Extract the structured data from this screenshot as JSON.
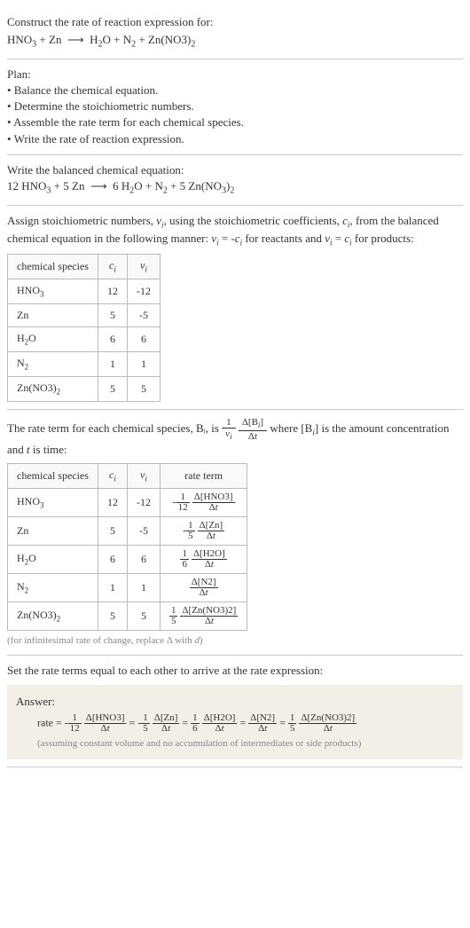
{
  "header": {
    "title": "Construct the rate of reaction expression for:",
    "equation": "HNO₃ + Zn ⟶ H₂O + N₂ + Zn(NO3)₂"
  },
  "plan": {
    "title": "Plan:",
    "items": [
      "• Balance the chemical equation.",
      "• Determine the stoichiometric numbers.",
      "• Assemble the rate term for each chemical species.",
      "• Write the rate of reaction expression."
    ]
  },
  "balanced": {
    "title": "Write the balanced chemical equation:",
    "equation": "12 HNO₃ + 5 Zn ⟶ 6 H₂O + N₂ + 5 Zn(NO₃)₂"
  },
  "stoich_text": {
    "intro": "Assign stoichiometric numbers, νᵢ, using the stoichiometric coefficients, cᵢ, from the balanced chemical equation in the following manner: νᵢ = -cᵢ for reactants and νᵢ = cᵢ for products:"
  },
  "stoich_table": {
    "headers": [
      "chemical species",
      "cᵢ",
      "νᵢ"
    ],
    "rows": [
      {
        "species": "HNO₃",
        "c": "12",
        "v": "-12"
      },
      {
        "species": "Zn",
        "c": "5",
        "v": "-5"
      },
      {
        "species": "H₂O",
        "c": "6",
        "v": "6"
      },
      {
        "species": "N₂",
        "c": "1",
        "v": "1"
      },
      {
        "species": "Zn(NO3)₂",
        "c": "5",
        "v": "5"
      }
    ]
  },
  "rate_term_text": {
    "intro_pre": "The rate term for each chemical species, Bᵢ, is ",
    "intro_post": " where [Bᵢ] is the amount concentration and t is time:"
  },
  "rate_table": {
    "headers": [
      "chemical species",
      "cᵢ",
      "νᵢ",
      "rate term"
    ],
    "rows": [
      {
        "species": "HNO₃",
        "c": "12",
        "v": "-12",
        "rate_prefix": "-",
        "rate_frac1_n": "1",
        "rate_frac1_d": "12",
        "rate_delta": "Δ[HNO3]",
        "rate_dt": "Δt"
      },
      {
        "species": "Zn",
        "c": "5",
        "v": "-5",
        "rate_prefix": "-",
        "rate_frac1_n": "1",
        "rate_frac1_d": "5",
        "rate_delta": "Δ[Zn]",
        "rate_dt": "Δt"
      },
      {
        "species": "H₂O",
        "c": "6",
        "v": "6",
        "rate_prefix": "",
        "rate_frac1_n": "1",
        "rate_frac1_d": "6",
        "rate_delta": "Δ[H2O]",
        "rate_dt": "Δt"
      },
      {
        "species": "N₂",
        "c": "1",
        "v": "1",
        "rate_prefix": "",
        "rate_frac1_n": "",
        "rate_frac1_d": "",
        "rate_delta": "Δ[N2]",
        "rate_dt": "Δt"
      },
      {
        "species": "Zn(NO3)₂",
        "c": "5",
        "v": "5",
        "rate_prefix": "",
        "rate_frac1_n": "1",
        "rate_frac1_d": "5",
        "rate_delta": "Δ[Zn(NO3)2]",
        "rate_dt": "Δt"
      }
    ],
    "note": "(for infinitesimal rate of change, replace Δ with d)"
  },
  "final": {
    "title": "Set the rate terms equal to each other to arrive at the rate expression:",
    "answer_label": "Answer:",
    "rate_prefix": "rate = ",
    "terms": [
      {
        "sign": "-",
        "fn": "1",
        "fd": "12",
        "dn": "Δ[HNO3]",
        "dd": "Δt"
      },
      {
        "sign": "-",
        "fn": "1",
        "fd": "5",
        "dn": "Δ[Zn]",
        "dd": "Δt"
      },
      {
        "sign": "",
        "fn": "1",
        "fd": "6",
        "dn": "Δ[H2O]",
        "dd": "Δt"
      },
      {
        "sign": "",
        "fn": "",
        "fd": "",
        "dn": "Δ[N2]",
        "dd": "Δt"
      },
      {
        "sign": "",
        "fn": "1",
        "fd": "5",
        "dn": "Δ[Zn(NO3)2]",
        "dd": "Δt"
      }
    ],
    "assumption": "(assuming constant volume and no accumulation of intermediates or side products)"
  },
  "chart_data": {
    "type": "table",
    "tables": [
      {
        "title": "Stoichiometric numbers",
        "headers": [
          "chemical species",
          "c_i",
          "ν_i"
        ],
        "rows": [
          [
            "HNO3",
            12,
            -12
          ],
          [
            "Zn",
            5,
            -5
          ],
          [
            "H2O",
            6,
            6
          ],
          [
            "N2",
            1,
            1
          ],
          [
            "Zn(NO3)2",
            5,
            5
          ]
        ]
      },
      {
        "title": "Rate terms",
        "headers": [
          "chemical species",
          "c_i",
          "ν_i",
          "rate term"
        ],
        "rows": [
          [
            "HNO3",
            12,
            -12,
            "-(1/12) Δ[HNO3]/Δt"
          ],
          [
            "Zn",
            5,
            -5,
            "-(1/5) Δ[Zn]/Δt"
          ],
          [
            "H2O",
            6,
            6,
            "(1/6) Δ[H2O]/Δt"
          ],
          [
            "N2",
            1,
            1,
            "Δ[N2]/Δt"
          ],
          [
            "Zn(NO3)2",
            5,
            5,
            "(1/5) Δ[Zn(NO3)2]/Δt"
          ]
        ]
      }
    ]
  }
}
